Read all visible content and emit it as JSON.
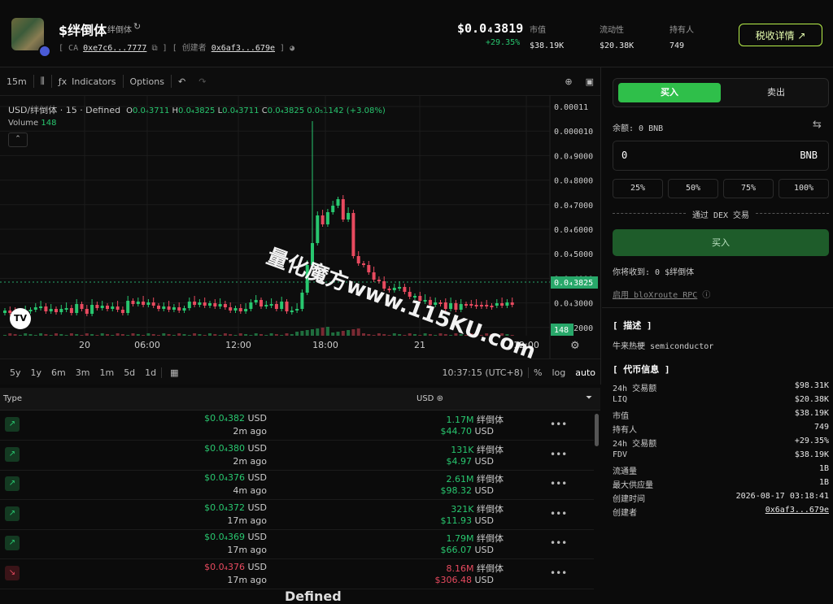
{
  "token": {
    "name": "$绊倒体",
    "subname": "绊倒体",
    "ca_label": "CA",
    "ca_value": "0xe7c6...7777",
    "creator_label": "创建者",
    "creator_value": "0x6af3...679e",
    "price": "$0.0₄3819",
    "change": "+29.35%"
  },
  "stats": [
    {
      "label": "市值",
      "value": "$38.19K"
    },
    {
      "label": "流动性",
      "value": "$20.38K"
    },
    {
      "label": "持有人",
      "value": "749"
    }
  ],
  "tax_button": "税收详情 ↗",
  "chart_toolbar": {
    "interval": "15m",
    "indicators": "Indicators",
    "options": "Options"
  },
  "ohlc": {
    "symbol": "USD/绊倒体 · 15 · Defined",
    "o": "0.0₄3711",
    "h": "0.0₄3825",
    "l": "0.0₄3711",
    "c": "0.0₄3825",
    "chg": "0.0₅1142 (+3.08%)"
  },
  "volume": {
    "label": "Volume",
    "value": "148"
  },
  "chart_data": {
    "type": "candlestick",
    "y_ticks": [
      "0.00011",
      "0.000010",
      "0.0₄9000",
      "0.0₄8000",
      "0.0₄7000",
      "0.0₄6000",
      "0.0₄5000",
      "0.0₄4000",
      "0.0₄3000",
      "0.0₄2000"
    ],
    "x_ticks": [
      "20",
      "06:00",
      "12:00",
      "18:00",
      "21",
      "12:00"
    ],
    "last_price_label": "0.0₄3825",
    "last_volume_label": "148"
  },
  "time_toolbar": {
    "ranges": [
      "5y",
      "1y",
      "6m",
      "3m",
      "1m",
      "5d",
      "1d"
    ],
    "clock": "10:37:15 (UTC+8)",
    "pct": "%",
    "log": "log",
    "auto": "auto"
  },
  "trades_header": {
    "type": "Type",
    "usd": "USD"
  },
  "trades": [
    {
      "side": "buy",
      "price": "$0.0₄382",
      "unit": "USD",
      "ago": "2m",
      "ago_unit": "ago",
      "amount": "1.17M",
      "token": "绊倒体",
      "usd": "$44.70",
      "usd_unit": "USD"
    },
    {
      "side": "buy",
      "price": "$0.0₄380",
      "unit": "USD",
      "ago": "2m",
      "ago_unit": "ago",
      "amount": "131K",
      "token": "绊倒体",
      "usd": "$4.97",
      "usd_unit": "USD"
    },
    {
      "side": "buy",
      "price": "$0.0₄376",
      "unit": "USD",
      "ago": "4m",
      "ago_unit": "ago",
      "amount": "2.61M",
      "token": "绊倒体",
      "usd": "$98.32",
      "usd_unit": "USD"
    },
    {
      "side": "buy",
      "price": "$0.0₄372",
      "unit": "USD",
      "ago": "17m",
      "ago_unit": "ago",
      "amount": "321K",
      "token": "绊倒体",
      "usd": "$11.93",
      "usd_unit": "USD"
    },
    {
      "side": "buy",
      "price": "$0.0₄369",
      "unit": "USD",
      "ago": "17m",
      "ago_unit": "ago",
      "amount": "1.79M",
      "token": "绊倒体",
      "usd": "$66.07",
      "usd_unit": "USD"
    },
    {
      "side": "sell",
      "price": "$0.0₄376",
      "unit": "USD",
      "ago": "17m",
      "ago_unit": "ago",
      "amount": "8.16M",
      "token": "绊倒体",
      "usd": "$306.48",
      "usd_unit": "USD"
    }
  ],
  "panel": {
    "buy_tab": "买入",
    "sell_tab": "卖出",
    "balance": "余额: 0 BNB",
    "amount_value": "0",
    "amount_unit": "BNB",
    "pcts": [
      "25%",
      "50%",
      "75%",
      "100%"
    ],
    "via": "通过 DEX 交易",
    "buy_button": "买入",
    "receive": "你将收到:  0 $绊倒体",
    "bloxroute": "启用 bloXroute RPC",
    "desc_title": "[ 描述 ]",
    "desc": "牛来热梗 semiconductor",
    "token_title": "[ 代币信息 ]",
    "info": [
      {
        "k": "24h 交易额",
        "v": "$98.31K"
      },
      {
        "k": "LIQ",
        "v": "$20.38K"
      },
      {
        "k": "市值",
        "v": "$38.19K"
      },
      {
        "k": "持有人",
        "v": "749"
      },
      {
        "k": "24h 交易额",
        "v": "+29.35%"
      },
      {
        "k": "FDV",
        "v": "$38.19K"
      },
      {
        "k": "流通量",
        "v": "1B"
      },
      {
        "k": "最大供应量",
        "v": "1B"
      },
      {
        "k": "创建时间",
        "v": "2026-08-17 03:18:41"
      },
      {
        "k": "创建者",
        "v": "0x6af3...679e"
      }
    ]
  },
  "watermark": "量化魔方www.115KU.com",
  "bottom_text": "Defined",
  "colors": {
    "up": "#28c76f",
    "down": "#e84a5f",
    "accent": "#b8f04a"
  }
}
